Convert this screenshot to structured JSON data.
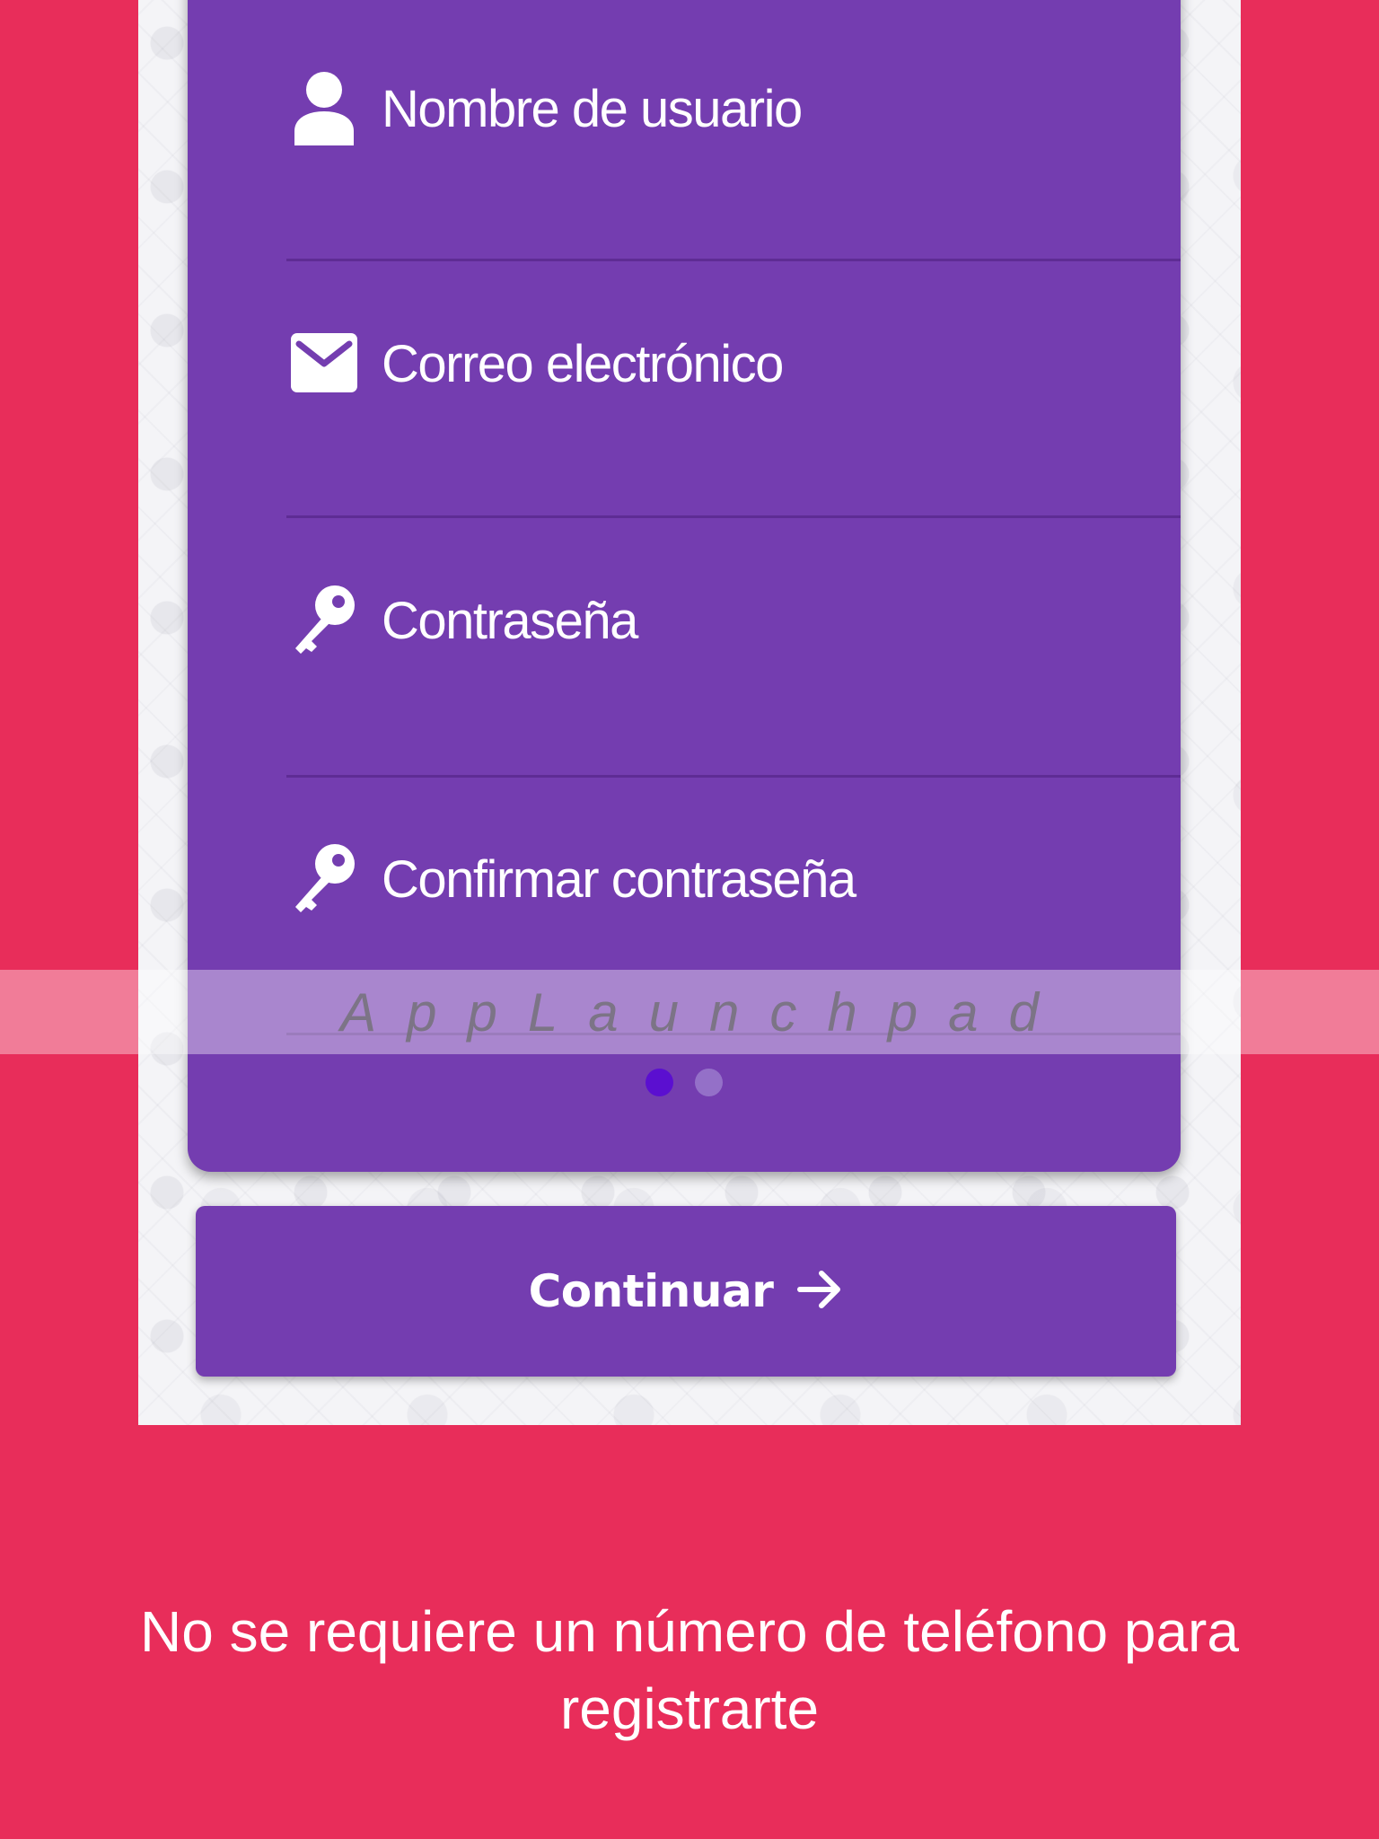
{
  "form": {
    "fields": [
      {
        "label": "Nombre de usuario",
        "icon": "user-icon"
      },
      {
        "label": "Correo electrónico",
        "icon": "envelope-icon"
      },
      {
        "label": "Contraseña",
        "icon": "key-icon"
      },
      {
        "label": "Confirmar contraseña",
        "icon": "key-icon"
      }
    ],
    "pager": {
      "current": 1,
      "total": 2
    }
  },
  "continue_button": {
    "label": "Continuar",
    "icon": "arrow-right-icon"
  },
  "watermark": {
    "text": "AppLaunchpad"
  },
  "caption": {
    "text": "No se requiere un número de teléfono para registrarte"
  },
  "colors": {
    "background": "#e82d5a",
    "card": "#743db0",
    "dot_active": "#5b0fd0",
    "dot_inactive": "#9470c8"
  }
}
